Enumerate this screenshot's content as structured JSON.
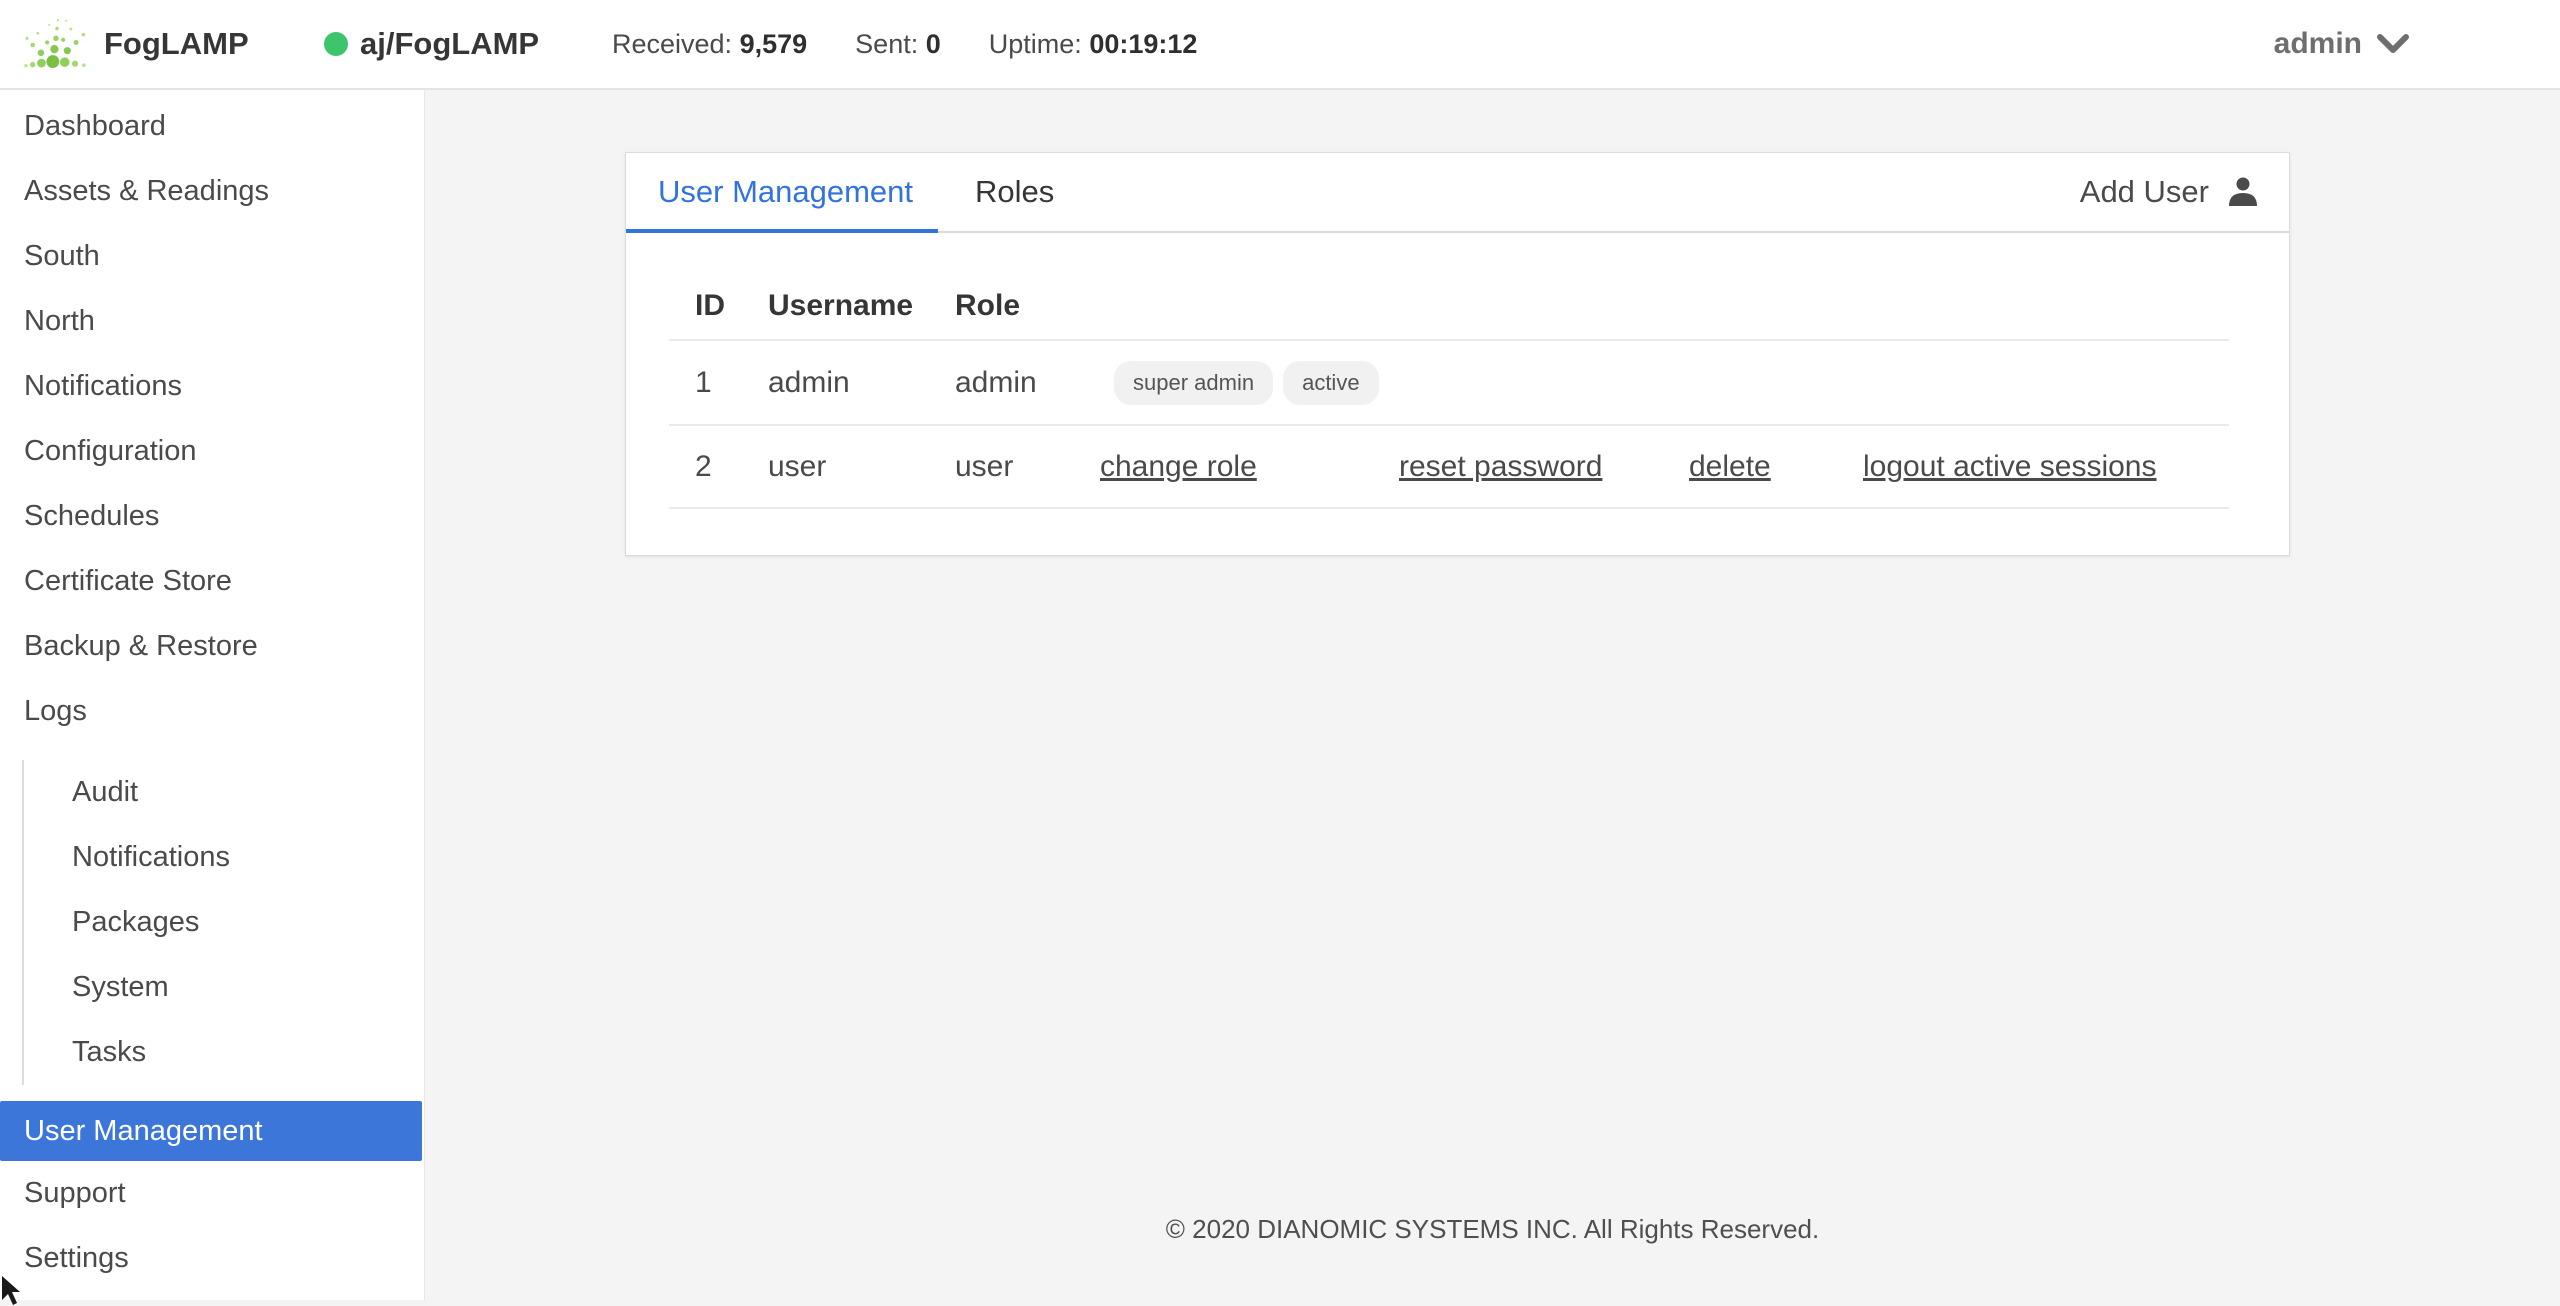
{
  "header": {
    "brand": "FogLAMP",
    "instance": {
      "name": "aj/FogLAMP",
      "status_color": "#3ec46d"
    },
    "stats": [
      {
        "label": "Received:",
        "value": "9,579"
      },
      {
        "label": "Sent:",
        "value": "0"
      },
      {
        "label": "Uptime:",
        "value": "00:19:12"
      }
    ],
    "user_menu_label": "admin"
  },
  "sidebar": {
    "items": [
      "Dashboard",
      "Assets & Readings",
      "South",
      "North",
      "Notifications",
      "Configuration",
      "Schedules",
      "Certificate Store",
      "Backup & Restore",
      "Logs"
    ],
    "log_subitems": [
      "Audit",
      "Notifications",
      "Packages",
      "System",
      "Tasks"
    ],
    "bottom_items": [
      {
        "label": "User Management",
        "active": true
      },
      {
        "label": "Support",
        "active": false
      },
      {
        "label": "Settings",
        "active": false
      }
    ]
  },
  "main": {
    "tabs": [
      {
        "label": "User Management",
        "active": true
      },
      {
        "label": "Roles",
        "active": false
      }
    ],
    "add_user_label": "Add User",
    "table": {
      "columns": [
        "ID",
        "Username",
        "Role"
      ],
      "rows": [
        {
          "id": "1",
          "username": "admin",
          "role": "admin",
          "badges": [
            "super admin",
            "active"
          ],
          "actions": []
        },
        {
          "id": "2",
          "username": "user",
          "role": "user",
          "badges": [],
          "actions": [
            "change role",
            "reset password",
            "delete",
            "logout active sessions"
          ]
        }
      ]
    }
  },
  "footer": {
    "copyright": "© 2020 DIANOMIC SYSTEMS INC. All Rights Reserved."
  },
  "colors": {
    "accent_blue": "#3273dc",
    "active_item_bg": "#3c76d9",
    "status_green": "#3ec46d"
  }
}
